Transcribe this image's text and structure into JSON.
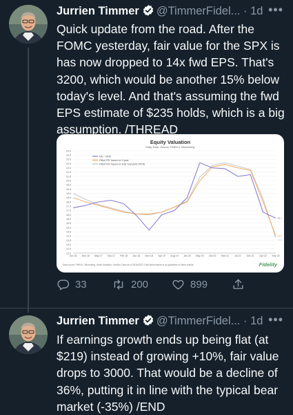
{
  "tweets": [
    {
      "name": "Jurrien Timmer",
      "handle": "@TimmerFidel...",
      "separator": "·",
      "time": "1d",
      "more": "•••",
      "text": "Quick update from the road. After the FOMC yesterday, fair value for the SPX is has now dropped to 14x fwd EPS. That's 3200, which would be another 15% below today's level. And that's assuming the fwd EPS estimate of $235 holds, which is a big assumption. /THREAD",
      "actions": {
        "replies": "33",
        "retweets": "200",
        "likes": "899"
      }
    },
    {
      "name": "Jurrien Timmer",
      "handle": "@TimmerFidel...",
      "separator": "·",
      "time": "1d",
      "more": "•••",
      "text": "If earnings growth ends up being flat (at $219) instead of growing +10%, fair value drops to 3000. That would be a decline of 36%, putting it in line with the typical bear market (-35%) /END"
    }
  ],
  "icons": [
    "verified-badge-icon",
    "reply-icon",
    "retweet-icon",
    "like-icon",
    "share-icon",
    "more-icon"
  ],
  "colors": {
    "background": "#15202b",
    "text": "#f7f9f9",
    "muted": "#8b98a5",
    "verified": "#1d9bf0",
    "divider": "#38444d"
  },
  "chart_data": {
    "type": "line",
    "title": "Equity Valuation",
    "subtitle": "Daily Data. Source: FMRCo, Bloomberg",
    "x": [
      "Jun 16",
      "Dec 16",
      "May 17",
      "Sep 17",
      "Feb 18",
      "Jun 18",
      "Nov 18",
      "Apr 19",
      "Aug 19",
      "Jan 20",
      "May 20",
      "Oct 20",
      "Mar 21",
      "Jul 21",
      "Dec 21",
      "Apr 22",
      "Sep 22"
    ],
    "ylim": [
      12.0,
      24.0
    ],
    "yticks": [
      "24.0",
      "23.5",
      "23.0",
      "22.5",
      "22.0",
      "21.5",
      "21.0",
      "20.5",
      "20.0",
      "19.5",
      "19.0",
      "18.5",
      "18.0",
      "17.5",
      "17.0",
      "16.5",
      "16.0",
      "15.5",
      "15.0",
      "14.5",
      "14.0",
      "13.5",
      "13.0",
      "12.5",
      "12.0"
    ],
    "series": [
      {
        "name": "P/E - NTM",
        "color": "#8a7fd0",
        "values": [
          17.3,
          17.6,
          18.0,
          18.2,
          17.8,
          16.4,
          14.7,
          16.5,
          17.0,
          18.5,
          22.6,
          22.0,
          21.9,
          21.0,
          21.2,
          16.8,
          16.1
        ]
      },
      {
        "name": "Fitted P/E based on 2-year",
        "color": "#f0a050",
        "values": [
          18.5,
          18.0,
          17.6,
          17.2,
          16.8,
          16.6,
          16.6,
          16.8,
          17.4,
          18.0,
          20.5,
          22.1,
          22.4,
          22.0,
          21.7,
          18.0,
          14.0
        ]
      },
      {
        "name": "Fitted P/E based on 10yr real yield (TIPS)",
        "color": "#c2c2c2",
        "values": [
          19.0,
          18.3,
          17.7,
          17.3,
          16.9,
          16.6,
          16.5,
          16.8,
          17.4,
          18.1,
          20.9,
          22.3,
          22.6,
          22.2,
          21.8,
          18.4,
          13.8
        ]
      }
    ],
    "end_labels": [
      "16.1",
      "14.0",
      "13.8"
    ],
    "source_note": "Data source: FMRCo, Bloomberg, Haver Analytics, FactSet. Data as of 09/16/2022. Past performance is no guarantee of future results.",
    "logo_text": "Fidelity"
  }
}
